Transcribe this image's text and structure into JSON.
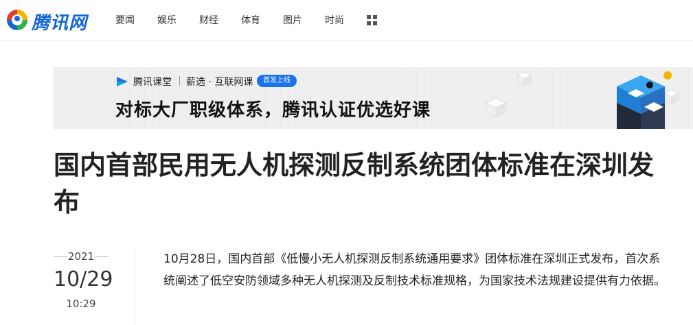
{
  "header": {
    "logo_text": "腾讯网",
    "nav": [
      "要闻",
      "娱乐",
      "财经",
      "体育",
      "图片",
      "时尚"
    ]
  },
  "banner": {
    "brand": "腾讯课堂",
    "subtitle": "薪选 · 互联网课",
    "badge": "首发上线",
    "headline": "对标大厂职级体系，腾讯认证优选好课"
  },
  "article": {
    "title": "国内首部民用无人机探测反制系统团体标准在深圳发布",
    "date": {
      "year": "2021",
      "day": "10/29",
      "time": "10:29"
    },
    "paragraph": "10月28日，国内首部《低慢小无人机探测反制系统通用要求》团体标准在深圳正式发布，首次系统阐述了低空安防领域多种无人机探测及反制技术标准规格，为国家技术法规建设提供有力依据。"
  },
  "colors": {
    "logo_blue": "#1466d6",
    "badge_blue": "#1a73e8"
  }
}
